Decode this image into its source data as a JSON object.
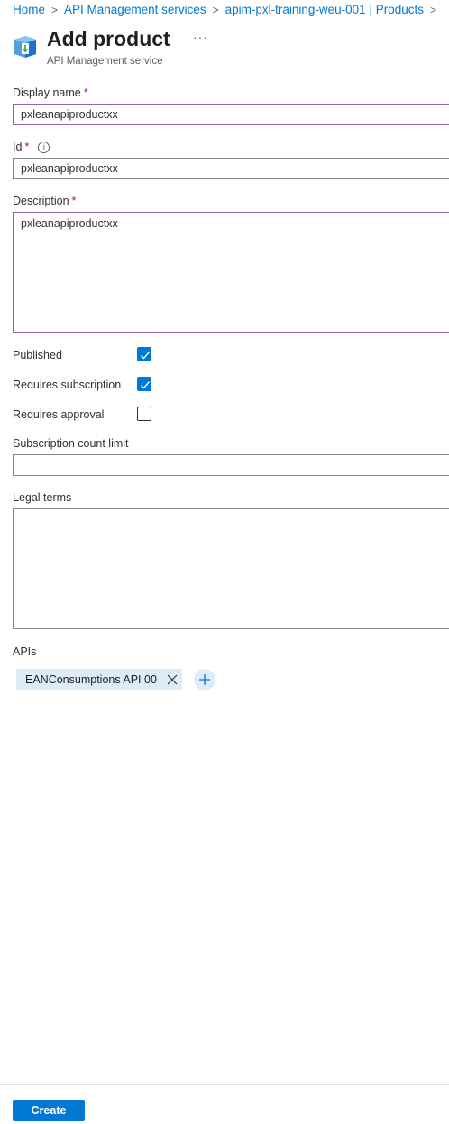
{
  "breadcrumb": {
    "home": "Home",
    "services": "API Management services",
    "instance": "apim-pxl-training-weu-001 | Products"
  },
  "header": {
    "title": "Add product",
    "subtitle": "API Management service",
    "more": "···"
  },
  "form": {
    "display_name": {
      "label": "Display name",
      "required_mark": "*",
      "value": "pxleanapiproductxx"
    },
    "id": {
      "label": "Id",
      "required_mark": "*",
      "value": "pxleanapiproductxx",
      "info_icon": "i"
    },
    "description": {
      "label": "Description",
      "required_mark": "*",
      "value": "pxleanapiproductxx"
    },
    "published": {
      "label": "Published",
      "checked": true
    },
    "requires_subscription": {
      "label": "Requires subscription",
      "checked": true
    },
    "requires_approval": {
      "label": "Requires approval",
      "checked": false
    },
    "subscription_count_limit": {
      "label": "Subscription count limit",
      "value": ""
    },
    "legal_terms": {
      "label": "Legal terms",
      "value": ""
    }
  },
  "apis": {
    "label": "APIs",
    "items": [
      {
        "name": "EANConsumptions API 00"
      }
    ]
  },
  "footer": {
    "create_label": "Create"
  },
  "colors": {
    "accent": "#0078d4",
    "required": "#a4262c",
    "tag_bg": "#deecf9",
    "active_border": "#8764b8"
  }
}
